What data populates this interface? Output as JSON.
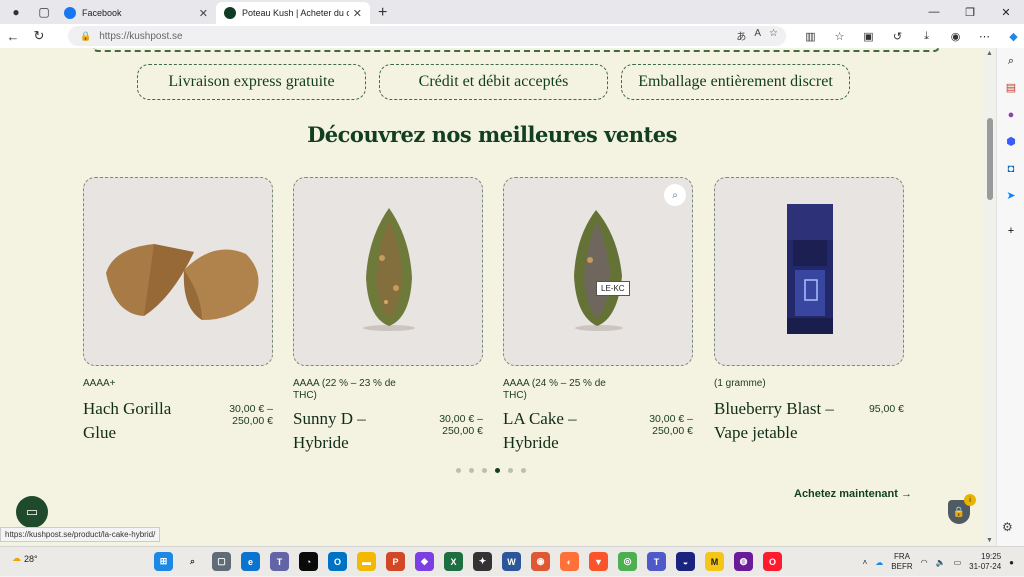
{
  "browser": {
    "tabs": [
      {
        "title": "Facebook",
        "active": false,
        "favicon_color": "#1877f2"
      },
      {
        "title": "Poteau Kush | Acheter du cannab",
        "active": true,
        "favicon_color": "#0f3b25"
      }
    ],
    "address": {
      "url": "https://kushpost.se"
    },
    "status_url": "https://kushpost.se/product/la-cake-hybrid/"
  },
  "page": {
    "features": [
      "Livraison express gratuite",
      "Crédit et débit acceptés",
      "Emballage entièrement discret"
    ],
    "heading": "Découvrez nos meilleures ventes",
    "products": [
      {
        "attr": "AAAA+",
        "name": "Hach Gorilla Glue",
        "price_lines": [
          "30,00 € –",
          "250,00 €"
        ]
      },
      {
        "attr": "AAAA (22 % – 23 % de THC)",
        "name": "Sunny D – Hybride",
        "price_lines": [
          "30,00 € –",
          "250,00 €"
        ]
      },
      {
        "attr": "AAAA (24 % – 25 % de THC)",
        "name": "LA Cake – Hybride",
        "price_lines": [
          "30,00 € –",
          "250,00 €"
        ]
      },
      {
        "attr": "(1 gramme)",
        "name": "Blueberry Blast – Vape jetable",
        "price_lines": [
          "95,00 €"
        ]
      }
    ],
    "tooltip": "LE-KC",
    "carousel": {
      "count": 6,
      "active": 3
    },
    "buy_now": "Achetez maintenant"
  },
  "taskbar": {
    "weather": "28°",
    "lang_top": "FRA",
    "lang_bottom": "BEFR",
    "time": "19:25",
    "date": "31-07-24"
  },
  "colors": {
    "accent": "#123f22",
    "page_bg": "#f4f3e2",
    "card_bg": "#e8e4e1"
  }
}
